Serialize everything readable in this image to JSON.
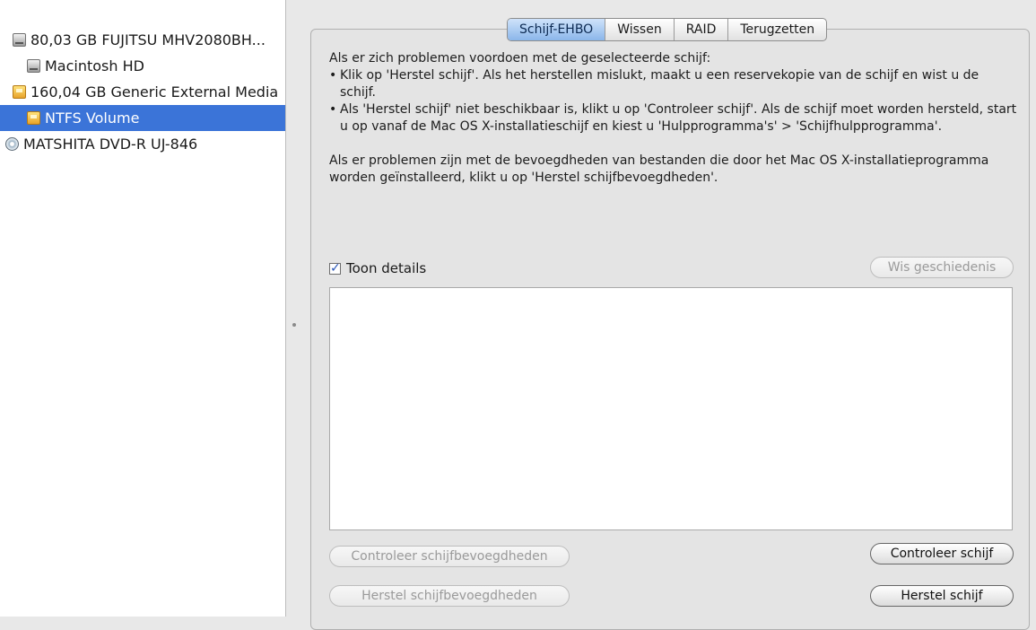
{
  "sidebar": {
    "items": [
      {
        "label": "80,03 GB FUJITSU MHV2080BH...",
        "icon": "hard-drive-icon"
      },
      {
        "label": "Macintosh HD",
        "icon": "hard-drive-icon"
      },
      {
        "label": "160,04 GB Generic External Media",
        "icon": "external-drive-icon"
      },
      {
        "label": "NTFS Volume",
        "icon": "external-drive-icon",
        "selected": true
      },
      {
        "label": "MATSHITA DVD-R UJ-846",
        "icon": "dvd-drive-icon"
      }
    ]
  },
  "tabs": [
    "Schijf-EHBO",
    "Wissen",
    "RAID",
    "Terugzetten"
  ],
  "active_tab": "Schijf-EHBO",
  "info": {
    "intro": "Als er zich problemen voordoen met de geselecteerde schijf:",
    "bullets": [
      "Klik op 'Herstel schijf'. Als het herstellen mislukt, maakt u een reservekopie van de schijf en wist u de schijf.",
      "Als 'Herstel schijf' niet beschikbaar is, klikt u op 'Controleer schijf'. Als de schijf moet worden hersteld, start u op vanaf de Mac OS X-installatieschijf en kiest u 'Hulpprogramma's' > 'Schijfhulpprogramma'."
    ],
    "paragraph2": "Als er problemen zijn met de bevoegdheden van bestanden die door het Mac OS X-installatieprogramma worden geïnstalleerd, klikt u op 'Herstel schijfbevoegdheden'."
  },
  "details": {
    "label": "Toon details",
    "checked": true
  },
  "buttons": {
    "clear_history": "Wis geschiedenis",
    "verify_permissions": "Controleer schijfbevoegdheden",
    "repair_permissions": "Herstel schijfbevoegdheden",
    "verify_disk": "Controleer schijf",
    "repair_disk": "Herstel schijf"
  },
  "colors": {
    "selection": "#3b74d8",
    "active_tab": "#8bb6ea"
  }
}
